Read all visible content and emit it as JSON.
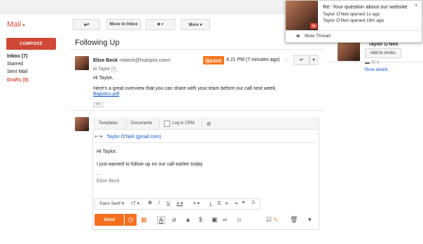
{
  "app": {
    "brand_label": "Mail",
    "brand_caret": "▾"
  },
  "compose_label": "COMPOSE",
  "nav": [
    {
      "label": "Inbox (7)",
      "style": "bold"
    },
    {
      "label": "Starred",
      "style": "normal"
    },
    {
      "label": "Sent Mail",
      "style": "normal"
    },
    {
      "label": "Drafts (8)",
      "style": "red"
    }
  ],
  "toolbar": {
    "back_icon": "↩",
    "move_to_inbox": "Move to Inbox",
    "labels_icon": "⬥ ▾",
    "more": "More ▾"
  },
  "thread": {
    "subject": "Following Up",
    "sender_name": "Elise Beck",
    "sender_email": "<ebeck@hubspot.com>",
    "to": "to Taylor",
    "save_badge": "SAVE",
    "timestamp": "4:21 PM (7 minutes ago)",
    "greeting": "Hi Taylor,",
    "body": "Here's a great overview that you can share with your team before our call next week.",
    "attachment": "Bigiytics.pdf",
    "ellipsis": "•••"
  },
  "reply": {
    "tabs": {
      "templates": "Templates",
      "documents": "Documents",
      "log_crm": "Log in CRM"
    },
    "to_name": "Taylor O'Neil (gmail.com)",
    "greeting": "Hi Taylor,",
    "line1": "I just wanted to follow up on our call earlier today",
    "sig_dash": "--",
    "signature": "Elise Beck",
    "font_name": "Sans Serif ▾",
    "send_label": "Send"
  },
  "popup": {
    "title": "Re: Your question about our website",
    "line1": "Taylor O'Neil opened 1s ago",
    "line2": "Taylor O'Neil opened 19m ago",
    "mute": "Mute Thread",
    "close": "×"
  },
  "contact": {
    "name": "Taylor O'Neil",
    "add_circles": "Add to circles",
    "show_details": "Show details"
  },
  "colors": {
    "accent": "#dd4b39",
    "orange": "#f4701f",
    "link": "#1155cc"
  }
}
